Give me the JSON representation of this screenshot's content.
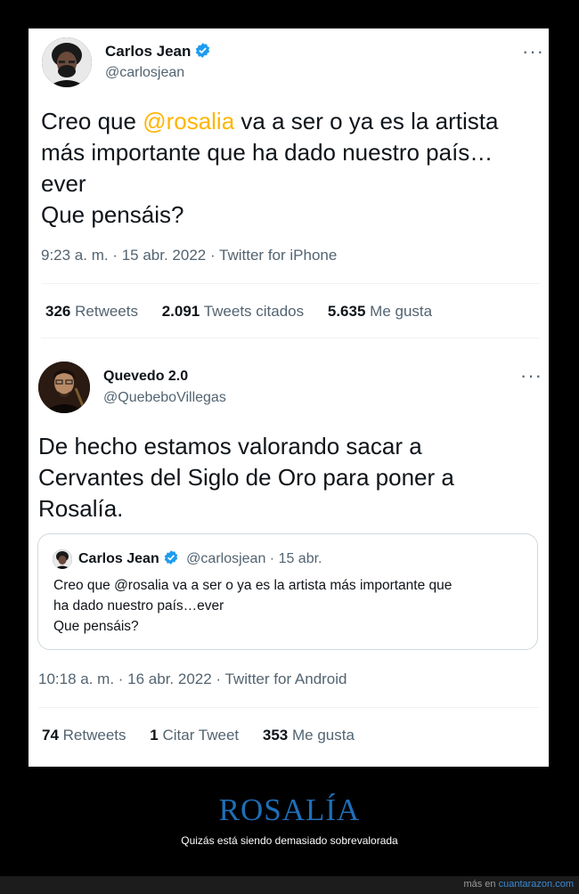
{
  "tweet1": {
    "name": "Carlos Jean",
    "handle": "@carlosjean",
    "text_before": "Creo que ",
    "mention": "@rosalia",
    "text_after": " va a ser o ya es la artista más importante que ha dado nuestro país… ever Que pensáis?",
    "line1_after": " va a ser o ya es la artista",
    "line2": "más importante que ha dado nuestro país…",
    "line3": "ever",
    "line4": "Que pensáis?",
    "meta": "9:23 a. m. · 15 abr. 2022 · Twitter for iPhone",
    "stats": [
      {
        "num": "326",
        "label": "Retweets"
      },
      {
        "num": "2.091",
        "label": "Tweets citados"
      },
      {
        "num": "5.635",
        "label": "Me gusta"
      }
    ],
    "more_icon": "more-horizontal-icon"
  },
  "tweet2": {
    "name": "Quevedo 2.0",
    "handle": "@QuebeboVillegas",
    "line1": "De hecho estamos valorando sacar a",
    "line2": "Cervantes del Siglo de Oro para poner a",
    "line3": "Rosalía.",
    "meta": "10:18 a. m. · 16 abr. 2022 · Twitter for Android",
    "stats": [
      {
        "num": "74",
        "label": "Retweets"
      },
      {
        "num": "1",
        "label": "Citar Tweet"
      },
      {
        "num": "353",
        "label": "Me gusta"
      }
    ],
    "quote": {
      "name": "Carlos Jean",
      "handle_date": "@carlosjean · 15 abr.",
      "line1": "Creo que @rosalia va a ser o ya es la artista más importante que",
      "line2": "ha dado nuestro país…ever",
      "line3": "Que pensáis?"
    }
  },
  "footer": {
    "title": "ROSALÍA",
    "subtitle": "Quizás está siendo demasiado sobrevalorada",
    "credit_prefix": "más en ",
    "credit_link": "cuantarazon.com"
  },
  "colors": {
    "mention": "#ffb500",
    "verified": "#1d9bf0",
    "footer_title": "#1e6fb8",
    "link": "#3a8ad6"
  }
}
